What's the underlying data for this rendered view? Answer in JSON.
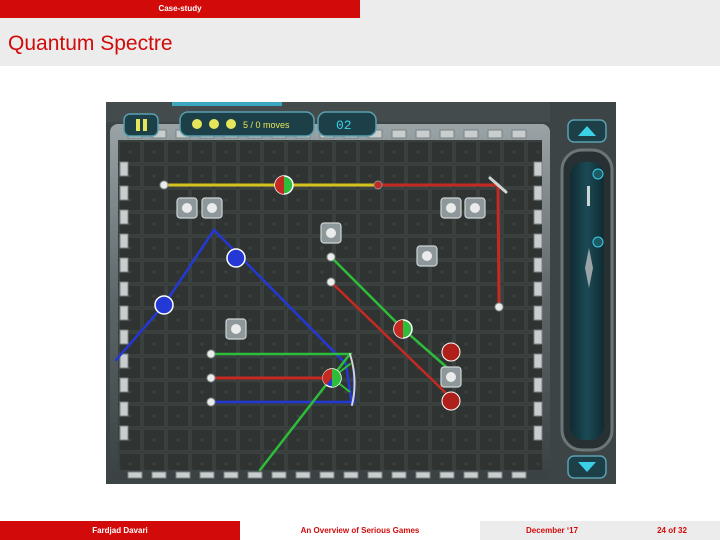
{
  "header": {
    "section": "Case-study",
    "frame_title": "Quantum Spectre"
  },
  "game": {
    "moves_text": "5 / 0 moves",
    "counter": "02",
    "colors": {
      "yellow": "#d6c21c",
      "red": "#c42a22",
      "green": "#2dbd3a",
      "blue": "#2438d6",
      "board": "#2e3331",
      "frame": "#1e4a52"
    }
  },
  "footer": {
    "author": "Fardjad Davari",
    "title": "An Overview of Serious Games",
    "date": "December ‘17",
    "page": "24 of 32"
  },
  "colors": {
    "accent": "#d20a0a",
    "bar_gray": "#ececec"
  }
}
